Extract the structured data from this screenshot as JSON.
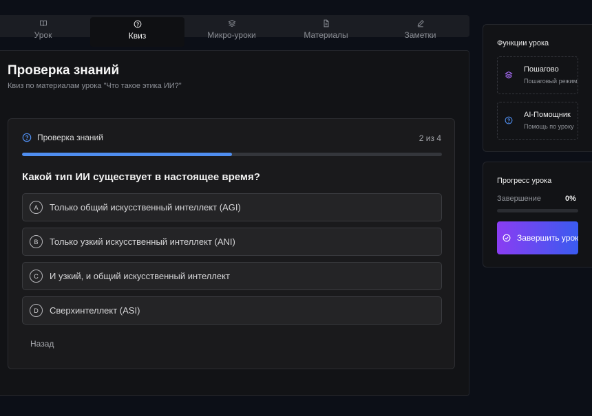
{
  "tabs": [
    {
      "label": "Урок",
      "icon": "book-icon",
      "active": false
    },
    {
      "label": "Квиз",
      "icon": "help-circle-icon",
      "active": true
    },
    {
      "label": "Микро-уроки",
      "icon": "layers-icon",
      "active": false
    },
    {
      "label": "Материалы",
      "icon": "file-text-icon",
      "active": false
    },
    {
      "label": "Заметки",
      "icon": "pen-icon",
      "active": false
    }
  ],
  "page": {
    "title": "Проверка знаний",
    "subtitle": "Квиз по материалам урока \"Что такое этика ИИ?\""
  },
  "quiz": {
    "header": "Проверка знаний",
    "counter": "2 из 4",
    "progress": 0.5,
    "question": "Какой тип ИИ существует в настоящее время?",
    "options": [
      {
        "letter": "A",
        "text": "Только общий искусственный интеллект (AGI)"
      },
      {
        "letter": "B",
        "text": "Только узкий искусственный интеллект (ANI)"
      },
      {
        "letter": "C",
        "text": "И узкий, и общий искусственный интеллект"
      },
      {
        "letter": "D",
        "text": "Сверхинтеллект (ASI)"
      }
    ],
    "back_label": "Назад"
  },
  "features": {
    "title": "Функции урока",
    "items": [
      {
        "title": "Пошагово",
        "subtitle": "Пошаговый режим",
        "icon": "layers-icon"
      },
      {
        "title": "AI-Помощник",
        "subtitle": "Помощь по уроку",
        "icon": "help-circle-icon"
      }
    ]
  },
  "lesson_progress": {
    "title": "Прогресс урока",
    "completion_label": "Завершение",
    "completion_value": "0%",
    "completion_fraction": 0,
    "finish_label": "Завершить урок"
  },
  "colors": {
    "accent_blue": "#4f8ef0",
    "accent_purple": "#8a3df2",
    "background": "#0c0f17"
  }
}
